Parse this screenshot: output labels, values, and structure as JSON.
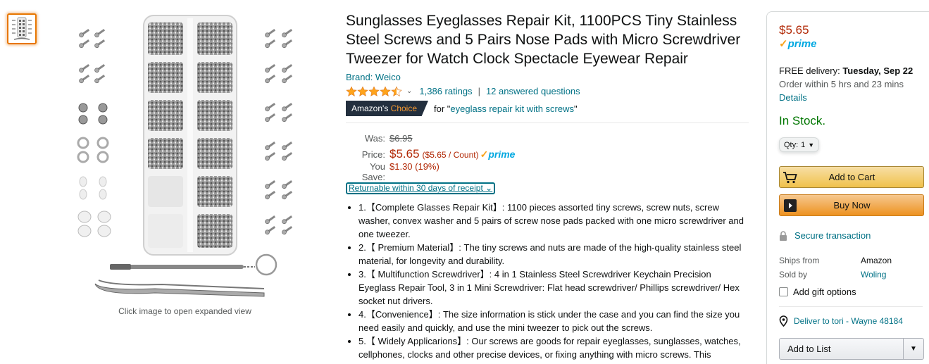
{
  "image": {
    "caption": "Click image to open expanded view"
  },
  "product": {
    "title": "Sunglasses Eyeglasses Repair Kit, 1100PCS Tiny Stainless Steel Screws and 5 Pairs Nose Pads with Micro Screwdriver Tweezer for Watch Clock Spectacle Eyewear Repair",
    "brand": "Brand: Weico",
    "rating_stars": 4.5,
    "ratings_count": "1,386 ratings",
    "answered_questions": "12 answered questions",
    "badge_prefix": "Amazon's",
    "badge_suffix": "Choice",
    "badge_for": "for \"",
    "badge_query": "eyeglass repair kit with screws",
    "badge_close": "\""
  },
  "pricing": {
    "was_label": "Was:",
    "was_value": "$6.95",
    "price_label": "Price:",
    "price_value": "$5.65",
    "per_unit": "($5.65 / Count)",
    "prime_check": "✓",
    "prime": "prime",
    "save_label": "You Save:",
    "save_value": "$1.30 (19%)",
    "returnable": "Returnable within 30 days of receipt",
    "returnable_chev": "⌄"
  },
  "bullets": [
    "1.【Complete Glasses Repair Kit】: 1100 pieces assorted tiny screws, screw nuts, screw washer, convex washer and 5 pairs of screw nose pads packed with one micro screwdriver and one tweezer.",
    "2.【 Premium Material】: The tiny screws and nuts are made of the high-quality stainless steel material, for longevity and durability.",
    "3.【 Multifunction Screwdriver】: 4 in 1 Stainless Steel Screwdriver Keychain Precision Eyeglass Repair Tool, 3 in 1 Mini Screwdriver: Flat head screwdriver/ Phillips screwdriver/ Hex socket nut drivers.",
    "4.【Convenience】: The size information is stick under the case and you can find the size you need easily and quickly, and use the mini tweezer to pick out the screws.",
    "5.【 Widely Applicarions】: Our screws are goods for repair eyeglasses, sunglasses, watches, cellphones, clocks and other precise devices, or fixing anything with micro screws. This"
  ],
  "buybox": {
    "price": "$5.65",
    "prime_check": "✓",
    "prime": "prime",
    "delivery_prefix": "FREE delivery: ",
    "delivery_date": "Tuesday, Sep 22",
    "order_within": "Order within 5 hrs and 23 mins",
    "details": "Details",
    "stock": "In Stock.",
    "qty_label": "Qty:",
    "qty_value": "1",
    "add_to_cart": "Add to Cart",
    "buy_now": "Buy Now",
    "secure": "Secure transaction",
    "ships_from_label": "Ships from",
    "ships_from_value": "Amazon",
    "sold_by_label": "Sold by",
    "sold_by_value": "Woling",
    "gift": "Add gift options",
    "deliver_to": "Deliver to tori - Wayne 48184",
    "add_to_list": "Add to List"
  },
  "colors": {
    "price": "#b12704",
    "link": "#007185",
    "instock": "#007600",
    "prime": "#00a8e1",
    "star": "#ffa41c"
  }
}
